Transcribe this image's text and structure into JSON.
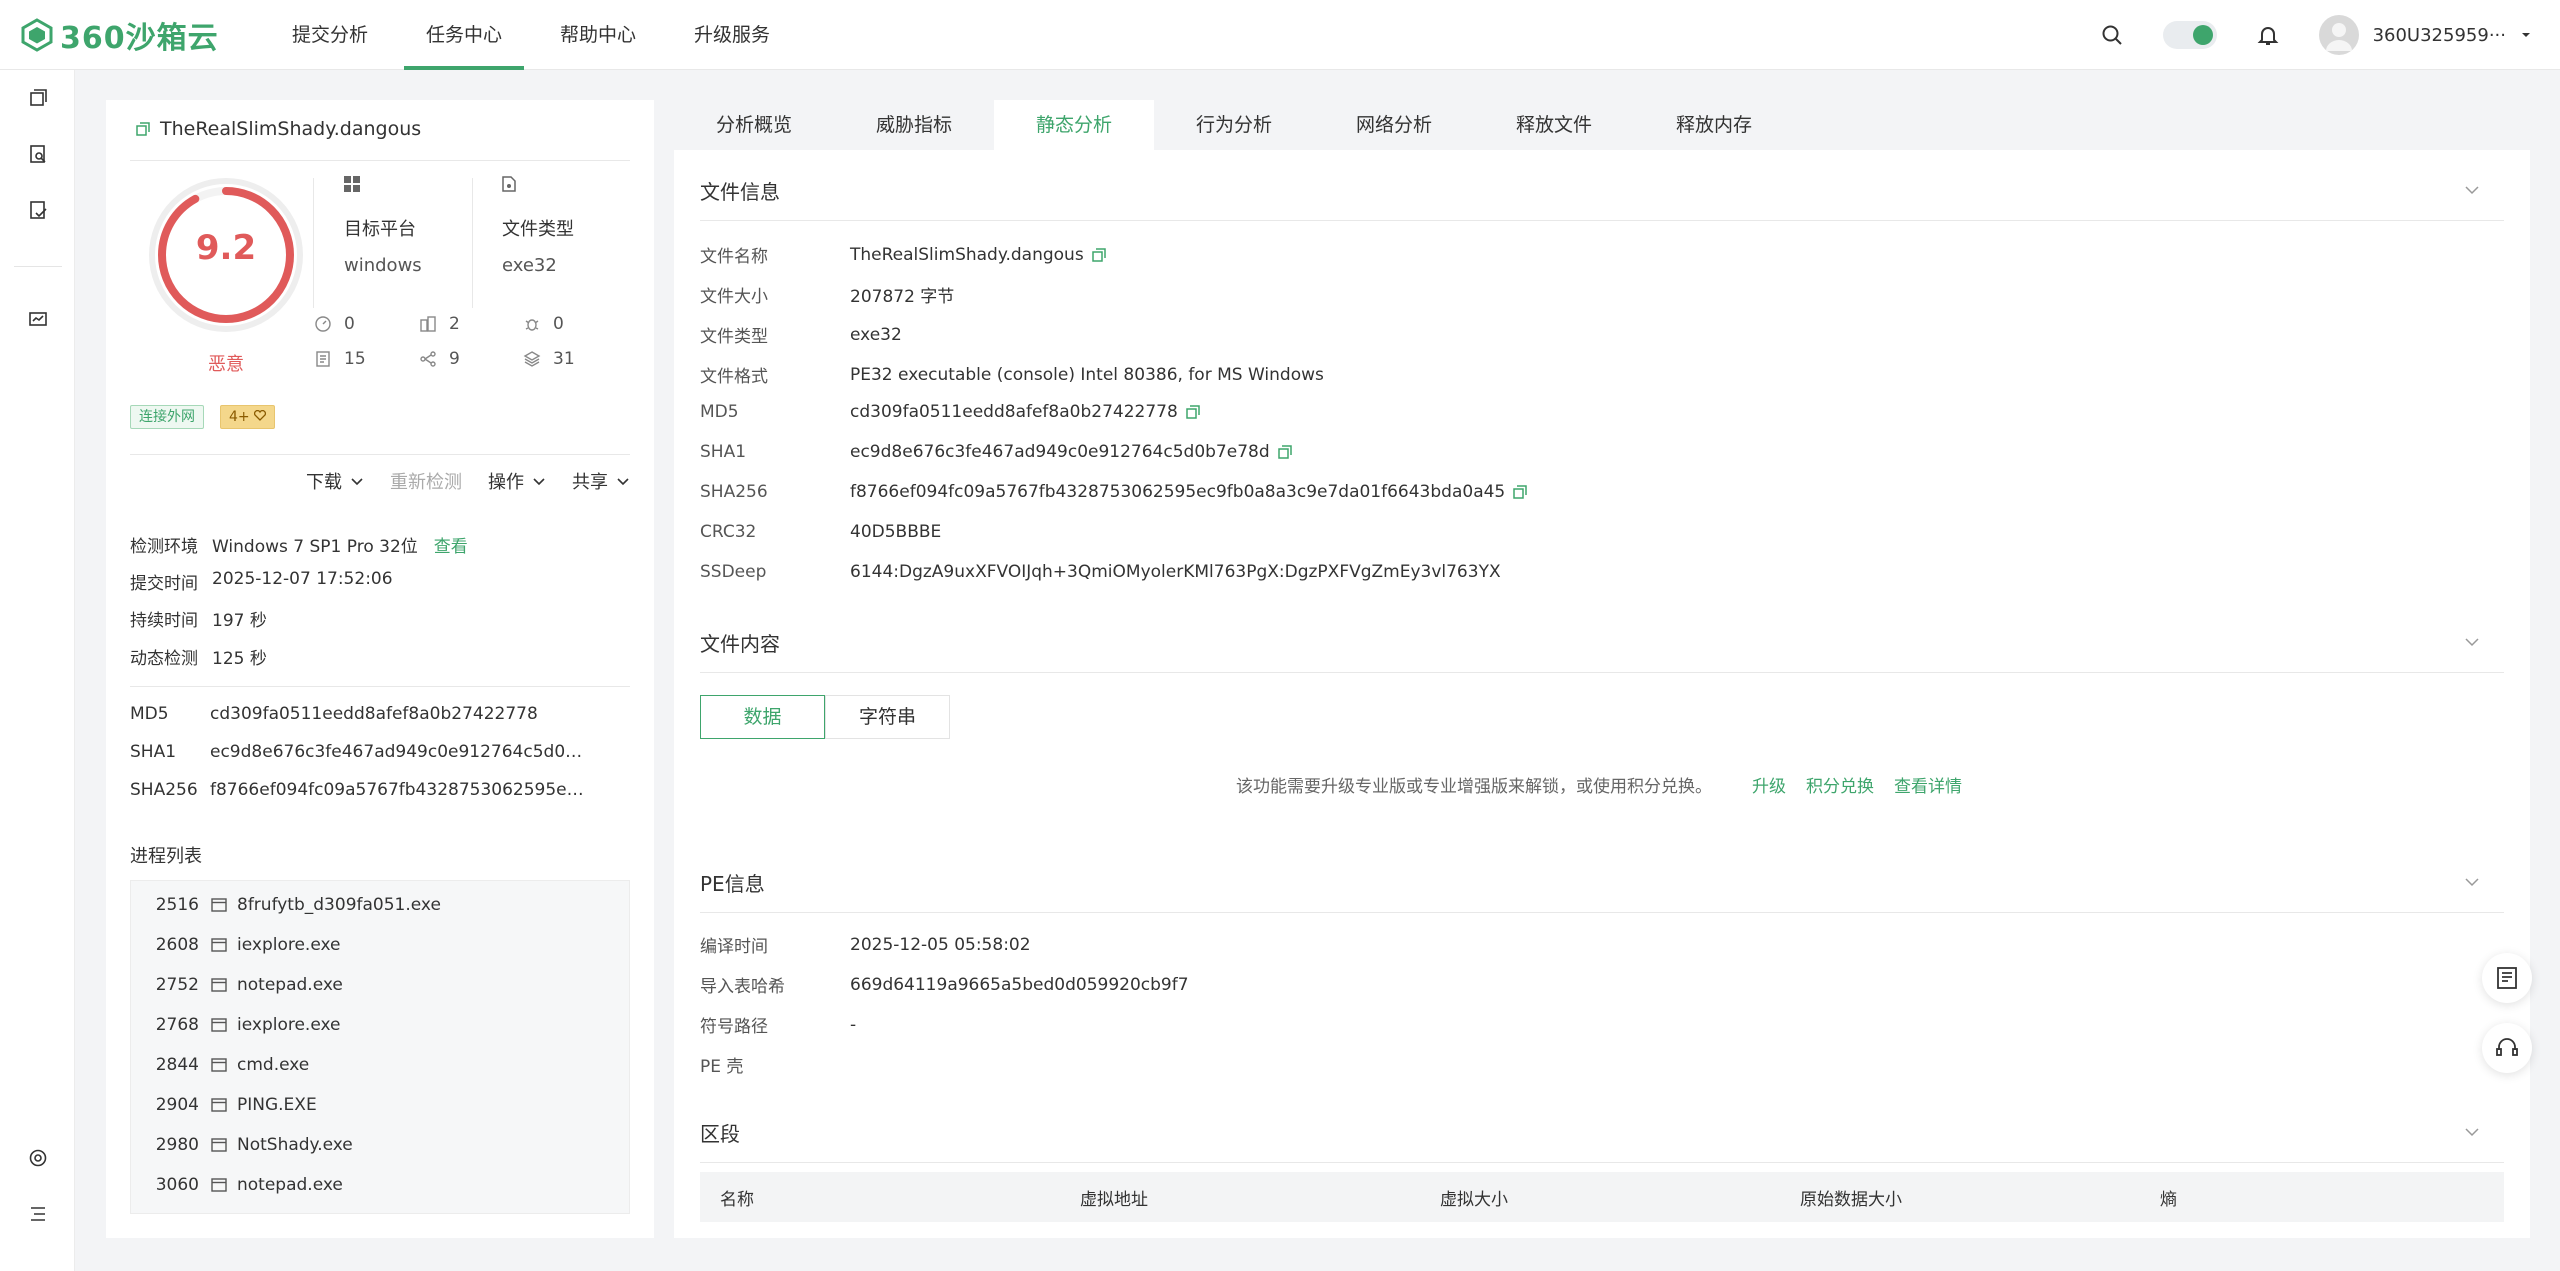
{
  "brand": {
    "logo_text": "360沙箱云"
  },
  "nav": {
    "items": [
      "提交分析",
      "任务中心",
      "帮助中心",
      "升级服务"
    ],
    "active": 1
  },
  "user": {
    "name": "360U325959···"
  },
  "summary": {
    "file_name": "TheRealSlimShady.dangous",
    "score": "9.2",
    "score_value": 9.2,
    "score_max": 10,
    "verdict": "恶意",
    "platform_label": "目标平台",
    "platform_value": "windows",
    "filetype_label": "文件类型",
    "filetype_value": "exe32",
    "stats": [
      "0",
      "2",
      "0",
      "15",
      "9",
      "31"
    ],
    "tags": {
      "network": "连接外网",
      "count": "4+"
    },
    "actions": {
      "download": "下载",
      "rescan": "重新检测",
      "operate": "操作",
      "share": "共享"
    },
    "info": [
      {
        "k": "检测环境",
        "v": "Windows 7 SP1 Pro 32位",
        "link": "查看"
      },
      {
        "k": "提交时间",
        "v": "2025-12-07 17:52:06"
      },
      {
        "k": "持续时间",
        "v": "197 秒"
      },
      {
        "k": "动态检测",
        "v": "125 秒"
      }
    ],
    "hashes": [
      {
        "k": "MD5",
        "v": "cd309fa0511eedd8afef8a0b27422778"
      },
      {
        "k": "SHA1",
        "v": "ec9d8e676c3fe467ad949c0e912764c5d0b7e···"
      },
      {
        "k": "SHA256",
        "v": "f8766ef094fc09a5767fb4328753062595ec9f···"
      }
    ],
    "process_title": "进程列表",
    "processes": [
      {
        "pid": "2516",
        "name": "8frufytb_d309fa051.exe"
      },
      {
        "pid": "2608",
        "name": "iexplore.exe"
      },
      {
        "pid": "2752",
        "name": "notepad.exe"
      },
      {
        "pid": "2768",
        "name": "iexplore.exe"
      },
      {
        "pid": "2844",
        "name": "cmd.exe"
      },
      {
        "pid": "2904",
        "name": "PING.EXE"
      },
      {
        "pid": "2980",
        "name": "NotShady.exe"
      },
      {
        "pid": "3060",
        "name": "notepad.exe"
      }
    ]
  },
  "tabs": {
    "items": [
      "分析概览",
      "威胁指标",
      "静态分析",
      "行为分析",
      "网络分析",
      "释放文件",
      "释放内存"
    ],
    "active": 2
  },
  "file_info": {
    "title": "文件信息",
    "rows": [
      {
        "k": "文件名称",
        "v": "TheRealSlimShady.dangous"
      },
      {
        "k": "文件大小",
        "v": "207872 字节"
      },
      {
        "k": "文件类型",
        "v": "exe32"
      },
      {
        "k": "文件格式",
        "v": "PE32 executable (console) Intel 80386, for MS Windows"
      },
      {
        "k": "MD5",
        "v": "cd309fa0511eedd8afef8a0b27422778"
      },
      {
        "k": "SHA1",
        "v": "ec9d8e676c3fe467ad949c0e912764c5d0b7e78d"
      },
      {
        "k": "SHA256",
        "v": "f8766ef094fc09a5767fb4328753062595ec9fb0a8a3c9e7da01f6643bda0a45"
      },
      {
        "k": "CRC32",
        "v": "40D5BBBE"
      },
      {
        "k": "SSDeep",
        "v": "6144:DgzA9uxXFVOIJqh+3QmiOMyolerKMl763PgX:DgzPXFVgZmEy3vl763YX"
      }
    ]
  },
  "file_content": {
    "title": "文件内容",
    "buttons": [
      "数据",
      "字符串"
    ],
    "notice": "该功能需要升级专业版或专业增强版来解锁，或使用积分兑换。",
    "links": [
      "升级",
      "积分兑换",
      "查看详情"
    ]
  },
  "pe_info": {
    "title": "PE信息",
    "rows": [
      {
        "k": "编译时间",
        "v": "2025-12-05 05:58:02"
      },
      {
        "k": "导入表哈希",
        "v": "669d64119a9665a5bed0d059920cb9f7"
      },
      {
        "k": "符号路径",
        "v": "-"
      },
      {
        "k": "PE 壳",
        "v": ""
      }
    ]
  },
  "sections": {
    "title": "区段",
    "columns": [
      "名称",
      "虚拟地址",
      "虚拟大小",
      "原始数据大小",
      "熵"
    ]
  }
}
